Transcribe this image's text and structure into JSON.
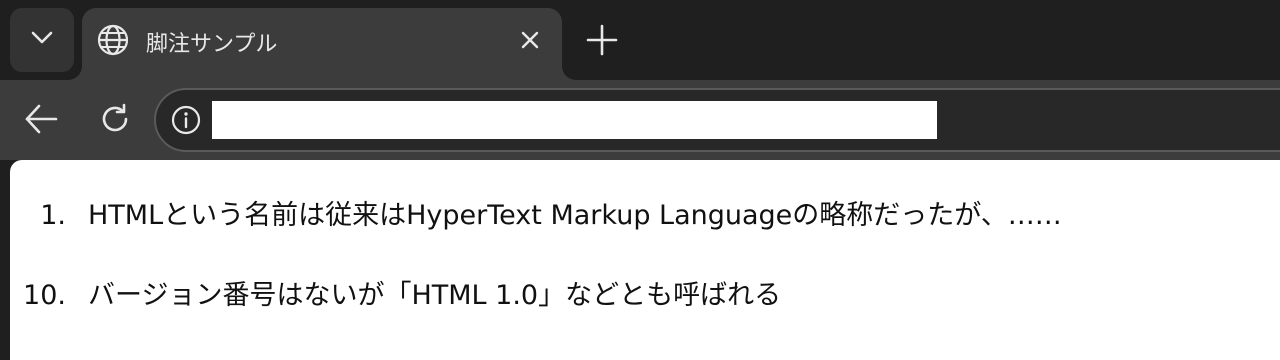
{
  "browser": {
    "tab": {
      "title": "脚注サンプル",
      "icon": "globe-icon"
    },
    "toolbar": {
      "address_value": "",
      "info_icon": "info-icon"
    },
    "colors": {
      "frame": "#1f1f1f",
      "tab_active": "#3c3c3c",
      "omnibox": "#282828",
      "content_bg": "#ffffff"
    }
  },
  "page": {
    "footnotes": [
      {
        "number": "1.",
        "text": "HTMLという名前は従来はHyperText Markup Languageの略称だったが、……"
      },
      {
        "number": "10.",
        "text": "バージョン番号はないが「HTML 1.0」などとも呼ばれる"
      }
    ]
  }
}
